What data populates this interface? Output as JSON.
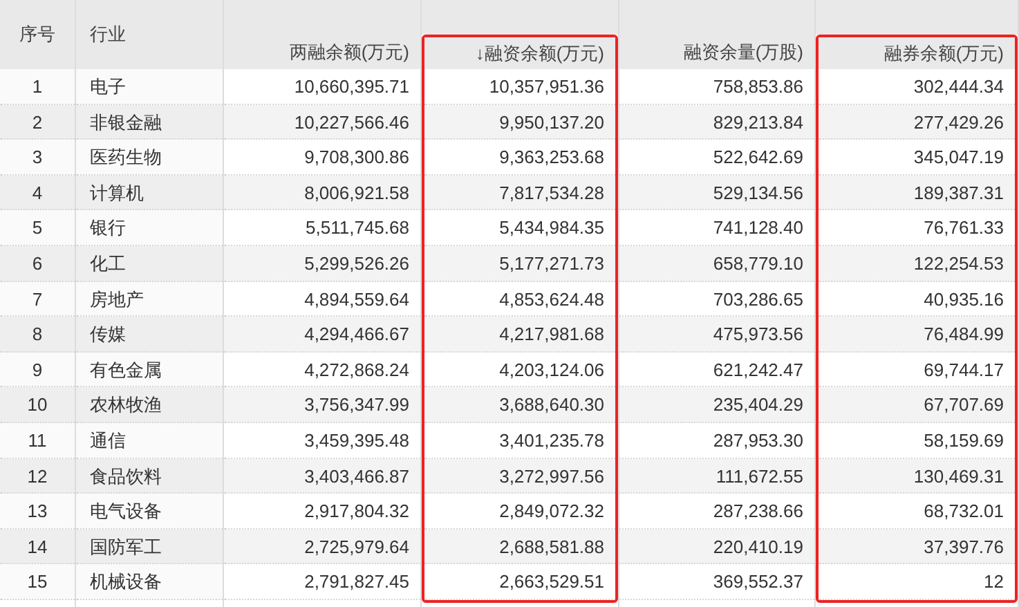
{
  "table": {
    "columns": [
      {
        "label": "序号",
        "kind": "index",
        "highlighted": false
      },
      {
        "label": "行业",
        "kind": "text",
        "highlighted": false
      },
      {
        "label": "两融余额(万元)",
        "kind": "number",
        "highlighted": false
      },
      {
        "label": "↓融资余额(万元)",
        "kind": "number",
        "highlighted": true
      },
      {
        "label": "融资余量(万股)",
        "kind": "number",
        "highlighted": false
      },
      {
        "label": "融券余额(万元)",
        "kind": "number",
        "highlighted": true
      }
    ],
    "rows": [
      [
        "1",
        "电子",
        "10,660,395.71",
        "10,357,951.36",
        "758,853.86",
        "302,444.34"
      ],
      [
        "2",
        "非银金融",
        "10,227,566.46",
        "9,950,137.20",
        "829,213.84",
        "277,429.26"
      ],
      [
        "3",
        "医药生物",
        "9,708,300.86",
        "9,363,253.68",
        "522,642.69",
        "345,047.19"
      ],
      [
        "4",
        "计算机",
        "8,006,921.58",
        "7,817,534.28",
        "529,134.56",
        "189,387.31"
      ],
      [
        "5",
        "银行",
        "5,511,745.68",
        "5,434,984.35",
        "741,128.40",
        "76,761.33"
      ],
      [
        "6",
        "化工",
        "5,299,526.26",
        "5,177,271.73",
        "658,779.10",
        "122,254.53"
      ],
      [
        "7",
        "房地产",
        "4,894,559.64",
        "4,853,624.48",
        "703,286.65",
        "40,935.16"
      ],
      [
        "8",
        "传媒",
        "4,294,466.67",
        "4,217,981.68",
        "475,973.56",
        "76,484.99"
      ],
      [
        "9",
        "有色金属",
        "4,272,868.24",
        "4,203,124.06",
        "621,242.47",
        "69,744.17"
      ],
      [
        "10",
        "农林牧渔",
        "3,756,347.99",
        "3,688,640.30",
        "235,404.29",
        "67,707.69"
      ],
      [
        "11",
        "通信",
        "3,459,395.48",
        "3,401,235.78",
        "287,953.30",
        "58,159.69"
      ],
      [
        "12",
        "食品饮料",
        "3,403,466.87",
        "3,272,997.56",
        "111,672.55",
        "130,469.31"
      ],
      [
        "13",
        "电气设备",
        "2,917,804.32",
        "2,849,072.32",
        "287,238.66",
        "68,732.01"
      ],
      [
        "14",
        "国防军工",
        "2,725,979.64",
        "2,688,581.88",
        "220,410.19",
        "37,397.76"
      ],
      [
        "15",
        "机械设备",
        "2,791,827.45",
        "2,663,529.51",
        "369,552.37",
        "12"
      ]
    ]
  }
}
